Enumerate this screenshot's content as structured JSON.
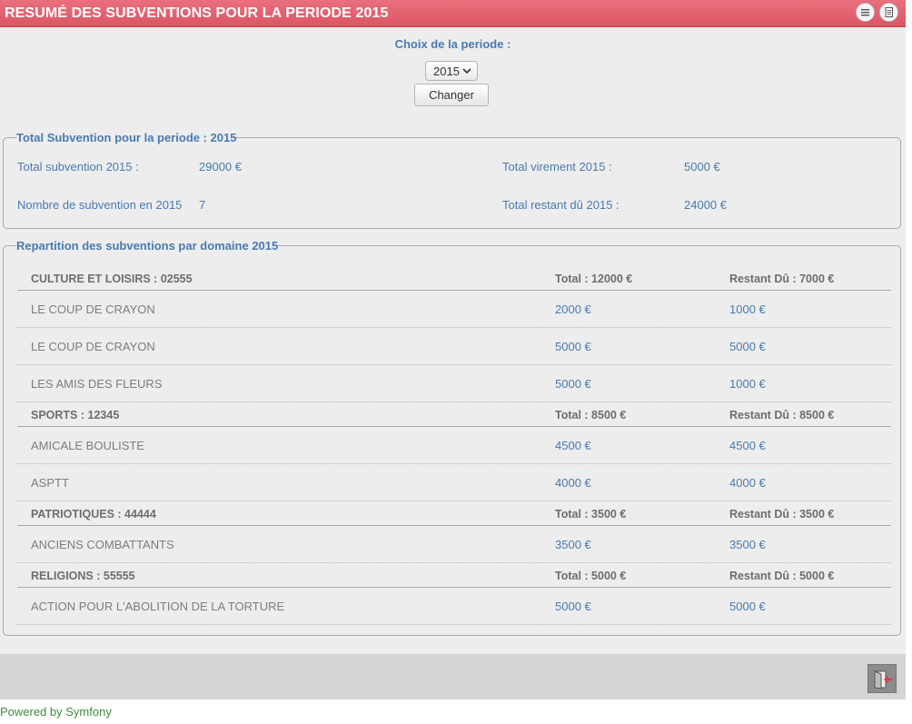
{
  "header": {
    "title": "RESUMÉ DES SUBVENTIONS POUR LA PERIODE 2015",
    "icons": [
      "menu-icon",
      "document-icon"
    ]
  },
  "period": {
    "label": "Choix de la periode :",
    "selected": "2015",
    "button": "Changer"
  },
  "summary": {
    "legend": "Total Subvention pour la periode : 2015",
    "total_label": "Total subvention 2015 :",
    "total_value": "29000 €",
    "count_label": "Nombre de subvention en 2015",
    "count_value": "7",
    "virement_label": "Total virement 2015 :",
    "virement_value": "5000 €",
    "restant_label": "Total restant dû 2015 :",
    "restant_value": "24000 €"
  },
  "repartition": {
    "legend": "Repartition des subventions par domaine 2015",
    "domains": [
      {
        "name": "CULTURE ET LOISIRS : 02555",
        "total": "Total : 12000 €",
        "restant": "Restant Dû : 7000 €",
        "items": [
          {
            "name": "LE COUP DE CRAYON",
            "amount": "2000 €",
            "due": "1000 €"
          },
          {
            "name": "LE COUP DE CRAYON",
            "amount": "5000 €",
            "due": "5000 €"
          },
          {
            "name": "LES AMIS DES FLEURS",
            "amount": "5000 €",
            "due": "1000 €"
          }
        ]
      },
      {
        "name": "SPORTS : 12345",
        "total": "Total : 8500 €",
        "restant": "Restant Dû : 8500 €",
        "items": [
          {
            "name": "AMICALE BOULISTE",
            "amount": "4500 €",
            "due": "4500 €"
          },
          {
            "name": "ASPTT",
            "amount": "4000 €",
            "due": "4000 €"
          }
        ]
      },
      {
        "name": "PATRIOTIQUES : 44444",
        "total": "Total : 3500 €",
        "restant": "Restant Dû : 3500 €",
        "items": [
          {
            "name": "ANCIENS COMBATTANTS",
            "amount": "3500 €",
            "due": "3500 €"
          }
        ]
      },
      {
        "name": "RELIGIONS : 55555",
        "total": "Total : 5000 €",
        "restant": "Restant Dû : 5000 €",
        "items": [
          {
            "name": "ACTION POUR L'ABOLITION DE LA TORTURE",
            "amount": "5000 €",
            "due": "5000 €"
          }
        ]
      }
    ]
  },
  "footer": {
    "powered": "Powered by Symfony",
    "logout_icon": "logout-icon"
  },
  "colors": {
    "header": "#dd5565",
    "accent": "#4a7ab0",
    "panel": "#ededed"
  }
}
